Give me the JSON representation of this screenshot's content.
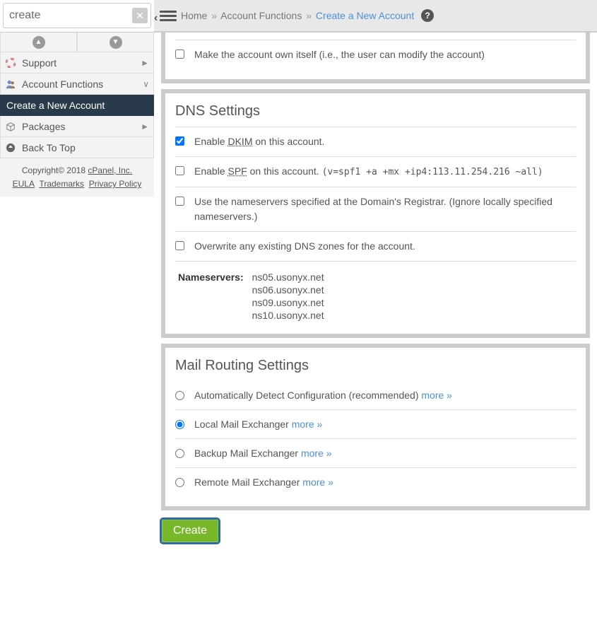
{
  "search": {
    "value": "create"
  },
  "breadcrumb": {
    "home": "Home",
    "section": "Account Functions",
    "page": "Create a New Account"
  },
  "sidebar": {
    "items": [
      {
        "label": "Support",
        "indicator": "►"
      },
      {
        "label": "Account Functions",
        "indicator": "∨"
      },
      {
        "label": "Create a New Account",
        "active": true
      },
      {
        "label": "Packages",
        "indicator": "►"
      },
      {
        "label": "Back To Top"
      }
    ],
    "copyright": "Copyright© 2018 ",
    "company": "cPanel, Inc.",
    "links": [
      "EULA",
      "Trademarks",
      "Privacy Policy"
    ]
  },
  "prev_section": {
    "own_itself": "Make the account own itself (i.e., the user can modify the account)"
  },
  "dns": {
    "heading": "DNS Settings",
    "dkim_pre": "Enable ",
    "dkim_abbr": "DKIM",
    "dkim_post": " on this account.",
    "spf_pre": "Enable ",
    "spf_abbr": "SPF",
    "spf_post": " on this account.  ",
    "spf_code": "(v=spf1 +a +mx +ip4:113.11.254.216 ~all)",
    "registrar": "Use the nameservers specified at the Domain's Registrar. (Ignore locally specified nameservers.)",
    "overwrite": "Overwrite any existing DNS zones for the account.",
    "ns_label": "Nameservers:",
    "nameservers": [
      "ns05.usonyx.net",
      "ns06.usonyx.net",
      "ns09.usonyx.net",
      "ns10.usonyx.net"
    ]
  },
  "mail": {
    "heading": "Mail Routing Settings",
    "auto": "Automatically Detect Configuration (recommended) ",
    "local": "Local Mail Exchanger ",
    "backup": "Backup Mail Exchanger ",
    "remote": "Remote Mail Exchanger ",
    "more": "more »"
  },
  "create_btn": "Create"
}
